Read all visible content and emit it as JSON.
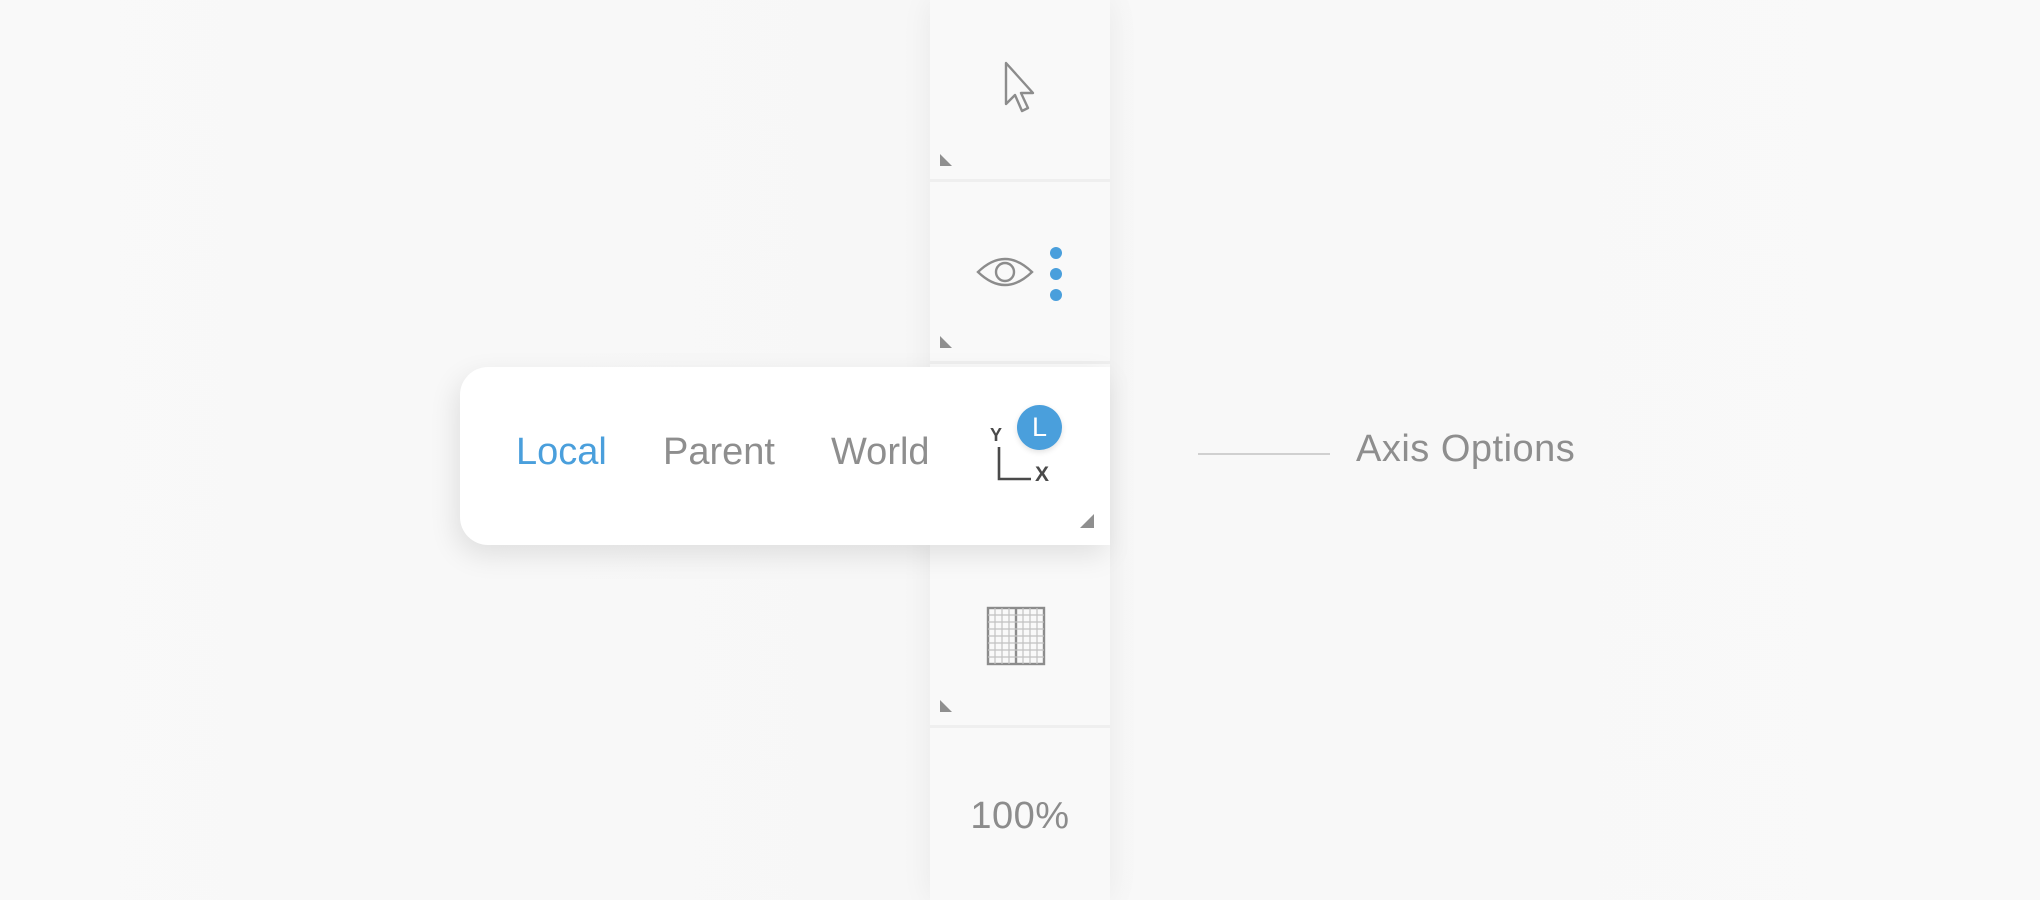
{
  "toolbar": {
    "tools": [
      {
        "name": "select",
        "icon": "pointer-arrow-icon"
      },
      {
        "name": "view",
        "icon": "eye-icon",
        "more_icon": "vertical-dots-icon"
      },
      {
        "name": "axis",
        "icon": "axis-gizmo-icon"
      },
      {
        "name": "grid",
        "icon": "grid-icon"
      }
    ],
    "zoom_label": "100%"
  },
  "axis_popover": {
    "options": [
      "Local",
      "Parent",
      "World"
    ],
    "selected": "Local",
    "axis_labels": {
      "y": "Y",
      "x": "X"
    },
    "badge": "L"
  },
  "callout": {
    "label": "Axis Options"
  },
  "colors": {
    "accent": "#4a9fdc",
    "icon_gray": "#8c8c8c",
    "background": "#f9f9f9",
    "popover": "#ffffff"
  }
}
